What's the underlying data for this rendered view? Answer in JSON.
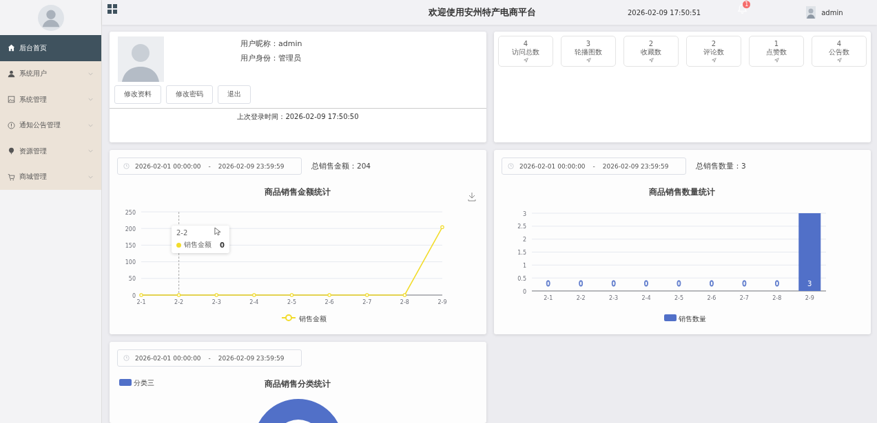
{
  "sidebar": {
    "items": [
      {
        "label": "后台首页",
        "selected": true
      },
      {
        "label": "系统用户",
        "selected": false,
        "expanded": false
      },
      {
        "label": "系统管理",
        "selected": false,
        "expanded": false
      },
      {
        "label": "通知公告管理",
        "selected": false,
        "expanded": false
      },
      {
        "label": "资源管理",
        "selected": false,
        "expanded": false
      },
      {
        "label": "商城管理",
        "selected": false,
        "expanded": false
      }
    ]
  },
  "header": {
    "title": "欢迎使用安州特产电商平台",
    "datetime": "2026-02-09 17:50:51",
    "notification_count": "1",
    "user": "admin"
  },
  "profile": {
    "nickname_label": "用户昵称：",
    "nickname": "admin",
    "role_label": "用户身份：",
    "role": "管理员",
    "buttons": [
      "修改资料",
      "修改密码",
      "退出"
    ],
    "last_login": "上次登录时间：2026-02-09 17:50:50"
  },
  "stats": [
    {
      "value": "4",
      "label": "访问总数"
    },
    {
      "value": "3",
      "label": "轮播图数"
    },
    {
      "value": "2",
      "label": "收藏数"
    },
    {
      "value": "2",
      "label": "评论数"
    },
    {
      "value": "1",
      "label": "点赞数"
    },
    {
      "value": "4",
      "label": "公告数"
    }
  ],
  "sales_amount": {
    "range_start": "2026-02-01 00:00:00",
    "separator": "-",
    "range_end": "2026-02-09 23:59:59",
    "total": "总销售金额：204",
    "chart_data": {
      "type": "line",
      "title": "商品销售金额统计",
      "categories": [
        "2-1",
        "2-2",
        "2-3",
        "2-4",
        "2-5",
        "2-6",
        "2-7",
        "2-8",
        "2-9"
      ],
      "series": [
        {
          "name": "销售金额",
          "color": "#f2dc2c",
          "values": [
            0,
            0,
            0,
            0,
            0,
            0,
            0,
            0,
            204
          ]
        }
      ],
      "ylim": [
        0,
        250
      ],
      "yticks": [
        0,
        50,
        100,
        150,
        200,
        250
      ],
      "grid": true,
      "marker": true,
      "ref_lines": [
        {
          "axis": "x",
          "value": "2-2"
        }
      ]
    },
    "tooltip": {
      "category": "2-2",
      "series": "销售金额",
      "value": "0"
    }
  },
  "sales_quantity": {
    "range_start": "2026-02-01 00:00:00",
    "separator": "-",
    "range_end": "2026-02-09 23:59:59",
    "total": "总销售数量：3",
    "chart_data": {
      "type": "bar",
      "title": "商品销售数量统计",
      "categories": [
        "2-1",
        "2-2",
        "2-3",
        "2-4",
        "2-5",
        "2-6",
        "2-7",
        "2-8",
        "2-9"
      ],
      "series": [
        {
          "name": "销售数量",
          "color": "#5170c8",
          "values": [
            0,
            0,
            0,
            0,
            0,
            0,
            0,
            0,
            3
          ]
        }
      ],
      "ylim": [
        0,
        3
      ],
      "yticks": [
        0,
        0.5,
        1,
        1.5,
        2,
        2.5,
        3
      ],
      "data_labels": true,
      "grid": true
    }
  },
  "sales_category": {
    "range_start": "2026-02-01 00:00:00",
    "separator": "-",
    "range_end": "2026-02-09 23:59:59",
    "title": "商品销售分类统计",
    "legend": [
      {
        "label": "分类三",
        "color": "#5170c8"
      }
    ]
  }
}
